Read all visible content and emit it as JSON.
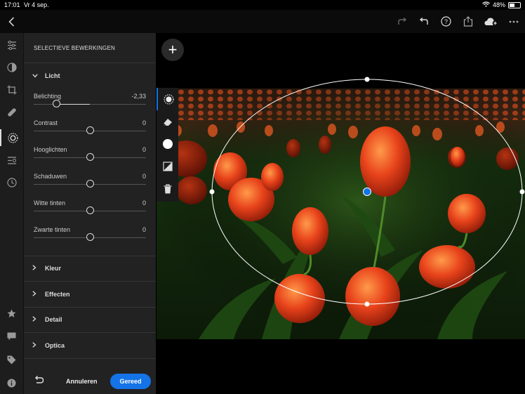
{
  "status": {
    "time": "17:01",
    "date": "Vr 4 sep.",
    "battery": "48%",
    "battery_level": 0.48,
    "wifi_icon": "wifi-icon"
  },
  "topbar": {
    "back_icon": "chevron-left-icon",
    "icons": [
      "redo-icon",
      "undo-icon",
      "help-icon",
      "share-icon",
      "cloud-sync-icon",
      "more-icon"
    ]
  },
  "rail": {
    "items": [
      "edit-sliders-icon",
      "presets-icon",
      "crop-icon",
      "healing-icon",
      "selective-icon",
      "versions-icon",
      "history-icon",
      "star-icon",
      "comment-icon",
      "tag-icon",
      "info-icon"
    ]
  },
  "panel": {
    "title": "SELECTIEVE BEWERKINGEN",
    "licht": {
      "label": "Licht",
      "sliders": [
        {
          "label": "Belichting",
          "value": "-2,33",
          "position": 0.2
        },
        {
          "label": "Contrast",
          "value": "0",
          "position": 0.5
        },
        {
          "label": "Hooglichten",
          "value": "0",
          "position": 0.5
        },
        {
          "label": "Schaduwen",
          "value": "0",
          "position": 0.5
        },
        {
          "label": "Witte tinten",
          "value": "0",
          "position": 0.5
        },
        {
          "label": "Zwarte tinten",
          "value": "0",
          "position": 0.5
        }
      ]
    },
    "sections": [
      "Kleur",
      "Effecten",
      "Detail",
      "Optica"
    ]
  },
  "footer": {
    "cancel": "Annuleren",
    "done": "Gereed",
    "reset_icon": "reset-icon"
  },
  "tools": [
    "radial-gradient-tool-icon",
    "eraser-icon",
    "mask-circle-icon",
    "invert-mask-icon",
    "trash-icon"
  ],
  "canvas": {
    "add_label": "+"
  }
}
